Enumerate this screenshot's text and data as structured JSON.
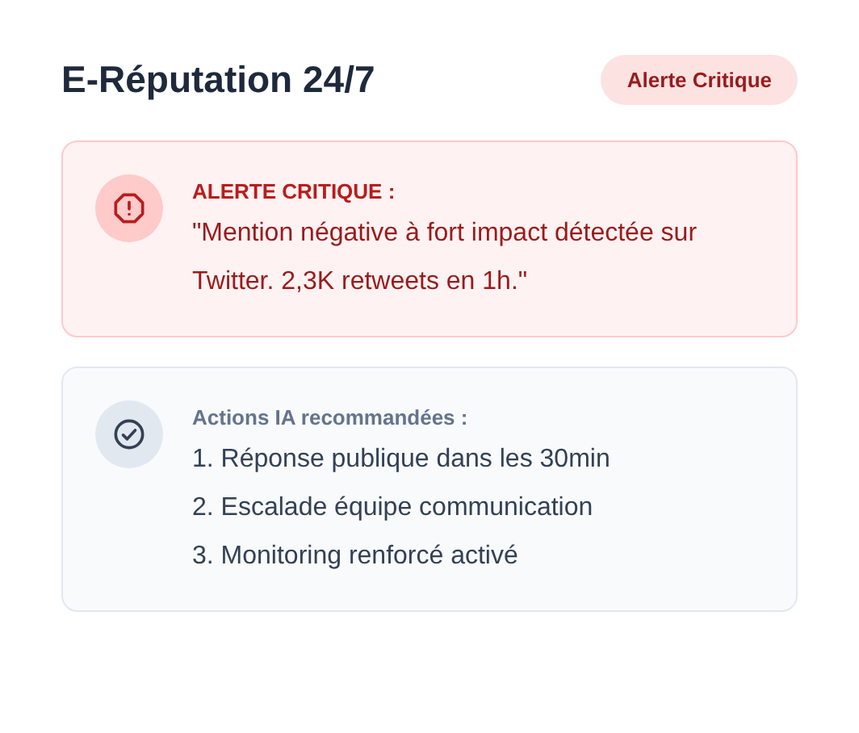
{
  "header": {
    "title": "E-Réputation 24/7",
    "badge": "Alerte Critique"
  },
  "cards": [
    {
      "kind": "alert",
      "title": "ALERTE CRITIQUE :",
      "lines": [
        "\"Mention négative à fort impact détectée sur Twitter. 2,3K retweets en 1h.\""
      ]
    },
    {
      "kind": "actions",
      "title": "Actions IA recommandées :",
      "lines": [
        "1. Réponse publique dans les 30min",
        "2. Escalade équipe communication",
        "3. Monitoring renforcé activé"
      ]
    }
  ]
}
